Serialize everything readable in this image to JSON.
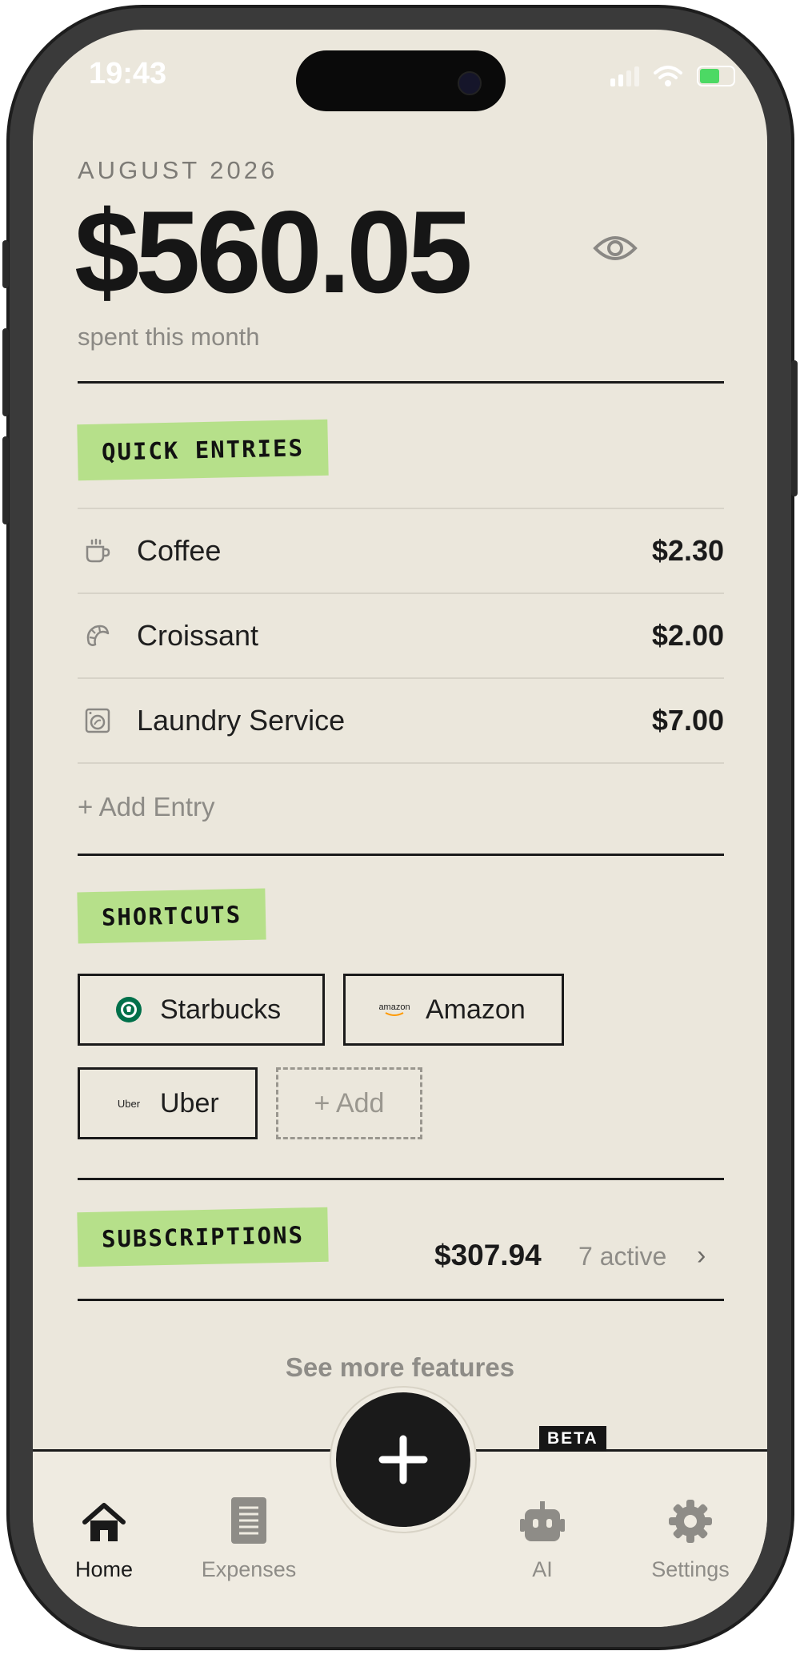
{
  "status_bar": {
    "time": "19:43"
  },
  "header": {
    "month": "AUGUST 2026",
    "total": "$560.05",
    "subtitle": "spent this month"
  },
  "quick_entries": {
    "title": "QUICK ENTRIES",
    "items": [
      {
        "name": "Coffee",
        "amount": "$2.30",
        "icon": "coffee-cup-icon"
      },
      {
        "name": "Croissant",
        "amount": "$2.00",
        "icon": "croissant-icon"
      },
      {
        "name": "Laundry Service",
        "amount": "$7.00",
        "icon": "washing-machine-icon"
      }
    ],
    "add_label": "+ Add Entry"
  },
  "shortcuts": {
    "title": "SHORTCUTS",
    "items": [
      {
        "label": "Starbucks",
        "logo": "starbucks-logo"
      },
      {
        "label": "Amazon",
        "logo_text": "amazon"
      },
      {
        "label": "Uber",
        "logo_text": "Uber"
      }
    ],
    "add_label": "+ Add"
  },
  "subscriptions": {
    "title": "SUBSCRIPTIONS",
    "amount": "$307.94",
    "active": "7 active"
  },
  "see_more": "See more features",
  "tabbar": {
    "home": "Home",
    "expenses": "Expenses",
    "ai": "AI",
    "ai_badge": "BETA",
    "settings": "Settings"
  },
  "colors": {
    "tag_green": "#b6e08a",
    "background": "#ebe7dc",
    "ink": "#1a1a1a"
  }
}
